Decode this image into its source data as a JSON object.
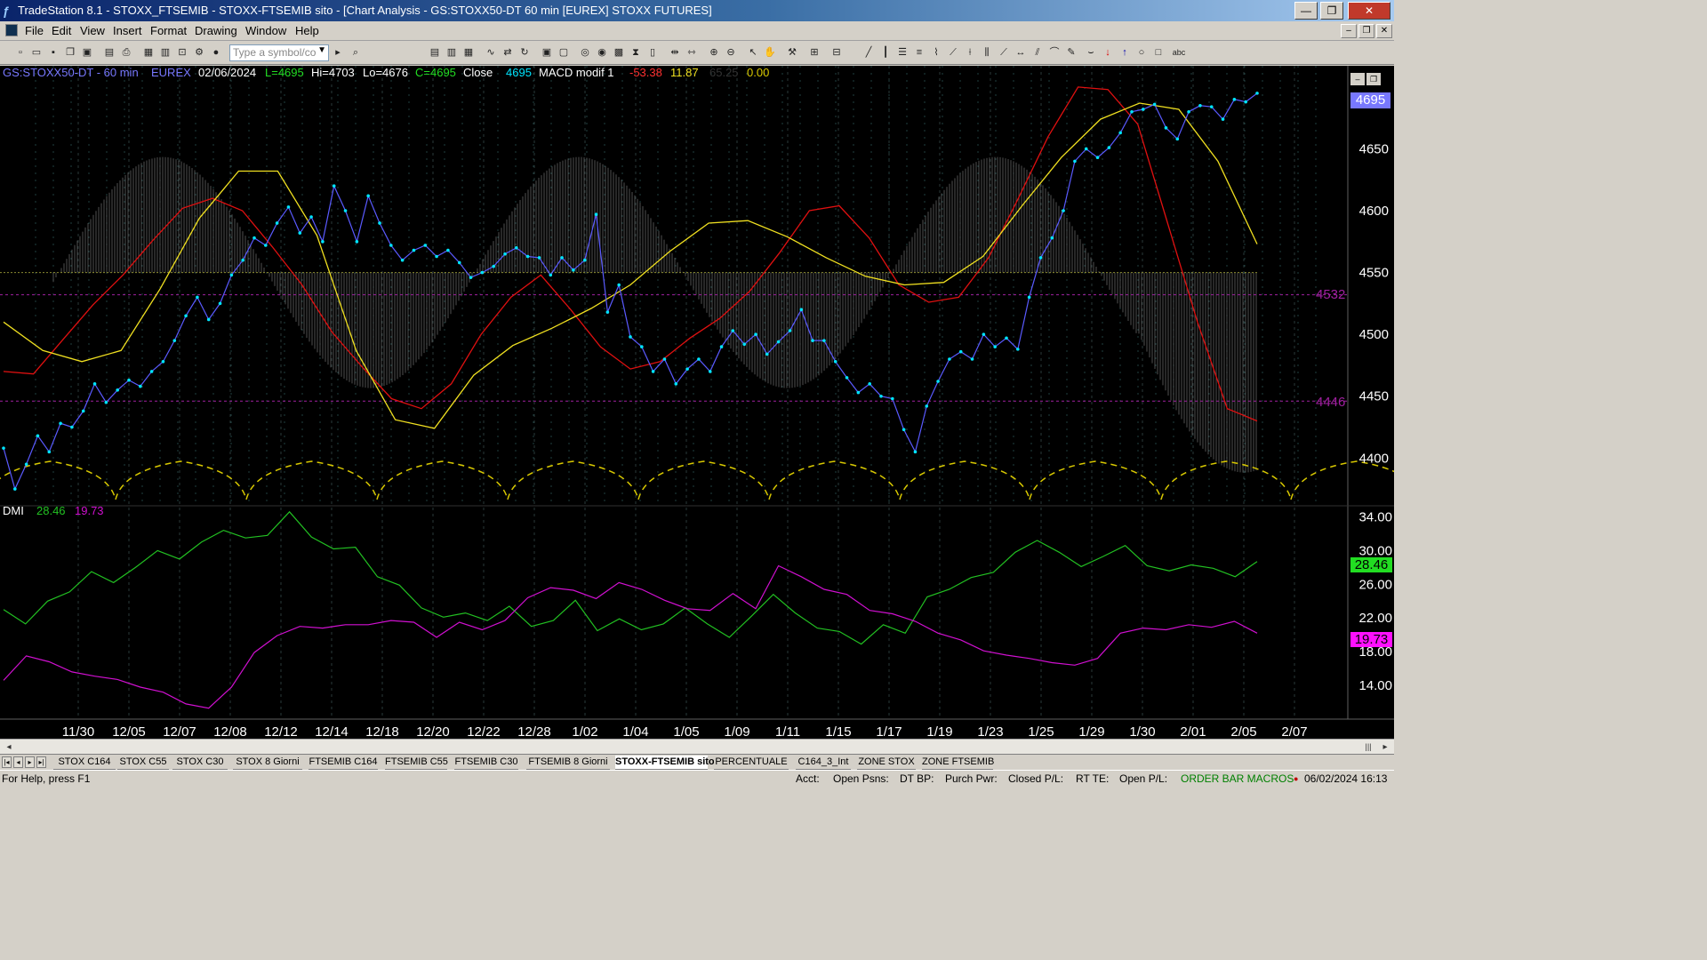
{
  "window": {
    "title": "TradeStation 8.1 - STOXX_FTSEMIB - STOXX-FTSEMIB sito - [Chart Analysis - GS:STOXX50-DT  60 min  [EUREX] STOXX FUTURES]",
    "min": "—",
    "max": "❐",
    "close": "✕"
  },
  "menu": [
    "File",
    "Edit",
    "View",
    "Insert",
    "Format",
    "Drawing",
    "Window",
    "Help"
  ],
  "toolbar": {
    "symbol_placeholder": "Type a symbol/co"
  },
  "header": {
    "symbol": "GS:STOXX50-DT - 60 min",
    "exchange": "EUREX",
    "date": "02/06/2024",
    "last": "L=4695",
    "hi": "Hi=4703",
    "lo": "Lo=4676",
    "close": "C=4695",
    "close_label": "Close",
    "close_value": "4695",
    "macd_label": "MACD modif 1",
    "macd_v1": "-53.38",
    "macd_v2": "11.87",
    "macd_v3": "65.25",
    "macd_v4": "0.00"
  },
  "colors": {
    "price": "#00e5ff",
    "price_line": "#5a5aff",
    "ma_red": "#e01010",
    "ma_yellow": "#f0e020",
    "cycle": "#d8c800",
    "dmi_plus": "#22c022",
    "dmi_minus": "#d010d0",
    "macd_hist": "#6a6a6a"
  },
  "chart_data": [
    {
      "type": "line",
      "title": "GS:STOXX50-DT - 60 min",
      "x_ticks": [
        "11/30",
        "12/05",
        "12/07",
        "12/08",
        "12/12",
        "12/14",
        "12/18",
        "12/20",
        "12/22",
        "12/28",
        "1/02",
        "1/04",
        "1/05",
        "1/09",
        "1/11",
        "1/15",
        "1/17",
        "1/19",
        "1/23",
        "1/25",
        "1/29",
        "1/30",
        "2/01",
        "2/05",
        "2/07"
      ],
      "ylim": [
        4365,
        4710
      ],
      "y_ticks": [
        4400,
        4450,
        4500,
        4550,
        4600,
        4650
      ],
      "last_price": 4695,
      "levels": [
        4532,
        4446
      ],
      "series": [
        {
          "name": "Close",
          "values": [
            4408,
            4375,
            4395,
            4418,
            4405,
            4428,
            4425,
            4438,
            4460,
            4445,
            4455,
            4463,
            4458,
            4470,
            4478,
            4495,
            4515,
            4530,
            4512,
            4525,
            4548,
            4560,
            4578,
            4572,
            4590,
            4603,
            4582,
            4595,
            4575,
            4620,
            4600,
            4575,
            4612,
            4590,
            4572,
            4560,
            4568,
            4572,
            4563,
            4568,
            4558,
            4546,
            4550,
            4555,
            4565,
            4570,
            4563,
            4562,
            4548,
            4562,
            4552,
            4560,
            4597,
            4518,
            4540,
            4498,
            4490,
            4470,
            4480,
            4460,
            4472,
            4480,
            4470,
            4490,
            4503,
            4492,
            4500,
            4484,
            4494,
            4503,
            4520,
            4495,
            4495,
            4478,
            4465,
            4453,
            4460,
            4450,
            4448,
            4423,
            4405,
            4442,
            4462,
            4480,
            4486,
            4480,
            4500,
            4490,
            4497,
            4488,
            4530,
            4562,
            4578,
            4600,
            4640,
            4650,
            4643,
            4651,
            4663,
            4680,
            4682,
            4686,
            4667,
            4658,
            4680,
            4685,
            4684,
            4674,
            4690,
            4688,
            4695
          ]
        },
        {
          "name": "Average 1",
          "values": [
            4470,
            4468,
            4496,
            4524,
            4548,
            4576,
            4602,
            4610,
            4600,
            4571,
            4540,
            4502,
            4474,
            4448,
            4440,
            4460,
            4500,
            4530,
            4548,
            4520,
            4490,
            4472,
            4478,
            4497,
            4513,
            4535,
            4566,
            4600,
            4604,
            4578,
            4540,
            4526,
            4530,
            4562,
            4610,
            4660,
            4700,
            4698,
            4670,
            4590,
            4510,
            4440,
            4430
          ]
        },
        {
          "name": "Average 2",
          "values": [
            4510,
            4487,
            4478,
            4487,
            4537,
            4594,
            4632,
            4632,
            4580,
            4487,
            4431,
            4424,
            4467,
            4491,
            4505,
            4521,
            4540,
            4567,
            4590,
            4592,
            4579,
            4562,
            4547,
            4540,
            4542,
            4563,
            4604,
            4643,
            4674,
            4687,
            4682,
            4640,
            4573
          ]
        }
      ]
    },
    {
      "type": "line",
      "title": "DMI",
      "ylim": [
        10,
        35
      ],
      "y_ticks": [
        14,
        18,
        22,
        26,
        30,
        34
      ],
      "series": [
        {
          "name": "DMI+",
          "last": 28.46,
          "values": [
            23,
            21.3,
            24,
            25.1,
            27.5,
            26.2,
            28,
            30,
            29,
            31,
            32.4,
            31.5,
            31.8,
            34.6,
            31.6,
            30.2,
            30.4,
            26.9,
            25.9,
            23.2,
            22.1,
            22.6,
            21.7,
            23.4,
            21,
            21.7,
            24.1,
            20.5,
            21.9,
            20.6,
            21.3,
            23.2,
            21.3,
            19.7,
            22.2,
            24.8,
            22.6,
            20.8,
            20.4,
            18.9,
            21.2,
            20.2,
            24.5,
            25.4,
            26.8,
            27.4,
            29.8,
            31.2,
            29.8,
            28.1,
            29.3,
            30.6,
            28.2,
            27.6,
            28.3,
            27.9,
            26.9,
            28.7
          ]
        },
        {
          "name": "DMI-",
          "last": 19.73,
          "values": [
            14.6,
            17.5,
            16.8,
            15.6,
            15.1,
            14.7,
            13.8,
            13.2,
            11.8,
            11.3,
            13.8,
            17.9,
            19.9,
            21,
            20.8,
            21.2,
            21.2,
            21.7,
            21.5,
            19.7,
            21.5,
            20.6,
            21.7,
            24.4,
            25.6,
            25.3,
            24.3,
            26.2,
            25.4,
            24.1,
            23.1,
            22.9,
            24.9,
            23.1,
            28.2,
            26.9,
            25.4,
            24.8,
            22.9,
            22.5,
            21.6,
            20.2,
            19.4,
            18.1,
            17.6,
            17.2,
            16.7,
            16.4,
            17.2,
            20.2,
            20.8,
            20.6,
            21.2,
            20.9,
            21.6,
            20.2
          ]
        }
      ]
    }
  ],
  "price_axis": {
    "last_badge": "4695",
    "levels": [
      "4532",
      "4446"
    ]
  },
  "dmi": {
    "label": "DMI",
    "plus": "28.46",
    "minus": "19.73",
    "plus_badge": "28.46",
    "minus_badge": "19.73"
  },
  "tabs": [
    "STOX C164",
    "STOX C55",
    "STOX  C30",
    "STOX  8 Giorni",
    "FTSEMIB C164",
    "FTSEMIB C55",
    "FTSEMIB C30",
    "FTSEMIB  8 Giorni",
    "STOXX-FTSEMIB sito",
    "PERCENTUALE",
    "C164_3_Int",
    "ZONE STOX",
    "ZONE FTSEMIB"
  ],
  "status": {
    "help": "For Help, press F1",
    "acct": "Acct:",
    "open_psns": "Open Psns:",
    "dt_bp": "DT BP:",
    "purch_pwr": "Purch Pwr:",
    "closed_pl": "Closed P/L:",
    "rt_te": "RT TE:",
    "open_pl": "Open P/L:",
    "macros": "ORDER BAR  MACROS",
    "datetime": "06/02/2024 16:13"
  }
}
